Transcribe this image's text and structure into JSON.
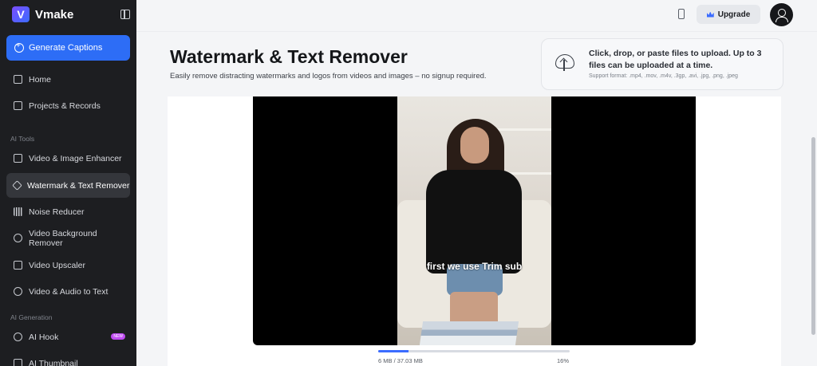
{
  "app": {
    "name": "Vmake",
    "logo_letter": "V"
  },
  "sidebar": {
    "cta_label": "Generate Captions",
    "items": [
      {
        "label": "Home"
      },
      {
        "label": "Projects & Records"
      }
    ],
    "ai_tools_label": "AI Tools",
    "ai_tools": [
      {
        "label": "Video & Image Enhancer"
      },
      {
        "label": "Watermark & Text Remover"
      },
      {
        "label": "Noise Reducer"
      },
      {
        "label": "Video Background Remover"
      },
      {
        "label": "Video Upscaler"
      },
      {
        "label": "Video & Audio to Text"
      }
    ],
    "ai_generation_label": "AI Generation",
    "ai_generation": [
      {
        "label": "AI Hook",
        "badge": "NEW"
      },
      {
        "label": "AI Thumbnail"
      }
    ]
  },
  "topbar": {
    "upgrade_label": "Upgrade"
  },
  "page": {
    "title": "Watermark & Text Remover",
    "subtitle": "Easily remove distracting watermarks and logos from videos and images – no signup required."
  },
  "upload": {
    "main_text": "Click, drop, or paste files to upload. Up to 3 files can be uploaded at a time.",
    "formats": "Support format: .mp4, .mov, .m4v, .3gp, .avi, .jpg, .png, .jpeg"
  },
  "video": {
    "caption": "first we use Trim sub"
  },
  "progress": {
    "size_text": "6 MB / 37.03 MB",
    "percent_text": "16%",
    "fraction": 0.16
  },
  "colors": {
    "accent": "#3b6cff",
    "sidebar_bg": "#1d1e21",
    "new_badge": "#c04bf2"
  }
}
